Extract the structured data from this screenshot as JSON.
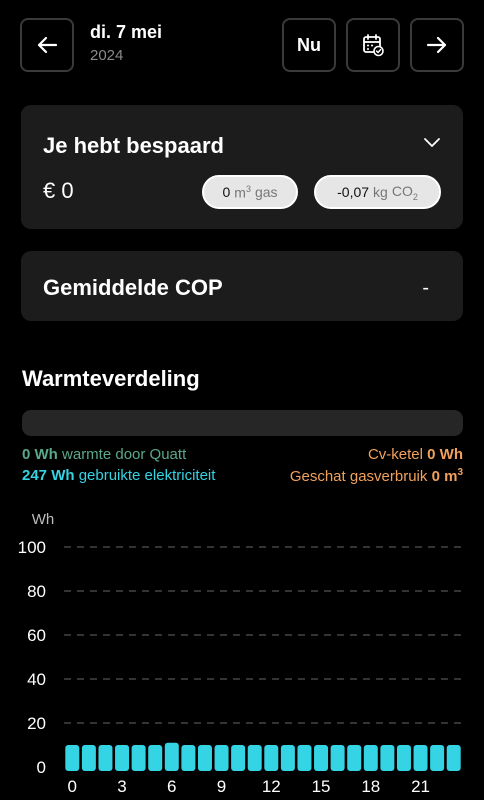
{
  "header": {
    "date_day": "di. 7 mei",
    "date_year": "2024",
    "now_label": "Nu",
    "prev_icon": "arrow-left-icon",
    "calendar_icon": "calendar-check-icon",
    "next_icon": "arrow-right-icon"
  },
  "savings": {
    "title": "Je hebt bespaard",
    "amount": "€ 0",
    "gas_value": "0",
    "gas_unit": "m",
    "gas_unit_sup": "3",
    "gas_label": "gas",
    "co2_value": "-0,07",
    "co2_unit": "kg",
    "co2_label": "CO",
    "co2_sub": "2"
  },
  "cop": {
    "title": "Gemiddelde COP",
    "value": "-"
  },
  "warmte": {
    "title": "Warmteverdeling",
    "quatt_value": "0 Wh",
    "quatt_label": "warmte door Quatt",
    "elec_value": "247 Wh",
    "elec_label": "gebruikte elektriciteit",
    "cv_label": "Cv-ketel",
    "cv_value": "0 Wh",
    "gas_label": "Geschat gasverbruik",
    "gas_value": "0 m",
    "gas_sup": "3"
  },
  "colors": {
    "accent_cyan": "#34d4e4",
    "quatt_green": "#5aa88a",
    "orange": "#f2a15c"
  },
  "chart_data": {
    "type": "bar",
    "ylabel": "Wh",
    "ylim": [
      0,
      100
    ],
    "yticks": [
      0,
      20,
      40,
      60,
      80,
      100
    ],
    "xticks": [
      0,
      3,
      6,
      9,
      12,
      15,
      18,
      21
    ],
    "grid": true,
    "categories": [
      0,
      1,
      2,
      3,
      4,
      5,
      6,
      7,
      8,
      9,
      10,
      11,
      12,
      13,
      14,
      15,
      16,
      17,
      18,
      19,
      20,
      21,
      22,
      23
    ],
    "series": [
      {
        "values": [
          10,
          10,
          10,
          10,
          10,
          10,
          11,
          10,
          10,
          10,
          10,
          10,
          10,
          10,
          10,
          10,
          10,
          10,
          10,
          10,
          10,
          10,
          10,
          10
        ],
        "color": "#34d4e4"
      }
    ]
  }
}
